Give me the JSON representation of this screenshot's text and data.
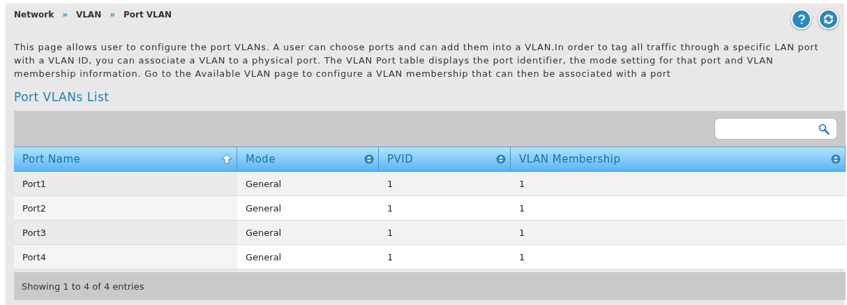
{
  "breadcrumb": [
    "Network",
    "VLAN",
    "Port VLAN"
  ],
  "breadcrumb_separator": "»",
  "description": "This page allows user to configure the port VLANs. A user can choose ports and can add them into a VLAN.In order to tag all traffic through a specific LAN port with a VLAN ID, you can associate a VLAN to a physical port. The VLAN Port table displays the port identifier, the mode setting for that port and VLAN membership information. Go to the Available VLAN page to configure a VLAN membership that can then be associated with a port",
  "section_title": "Port VLANs List",
  "table": {
    "columns": [
      {
        "label": "Port Name",
        "sorted": true
      },
      {
        "label": "Mode",
        "sorted": false
      },
      {
        "label": "PVID",
        "sorted": false
      },
      {
        "label": "VLAN Membership",
        "sorted": false
      }
    ],
    "rows": [
      [
        "Port1",
        "General",
        "1",
        "1"
      ],
      [
        "Port2",
        "General",
        "1",
        "1"
      ],
      [
        "Port3",
        "General",
        "1",
        "1"
      ],
      [
        "Port4",
        "General",
        "1",
        "1"
      ]
    ]
  },
  "footer": "Showing 1 to 4 of 4 entries"
}
